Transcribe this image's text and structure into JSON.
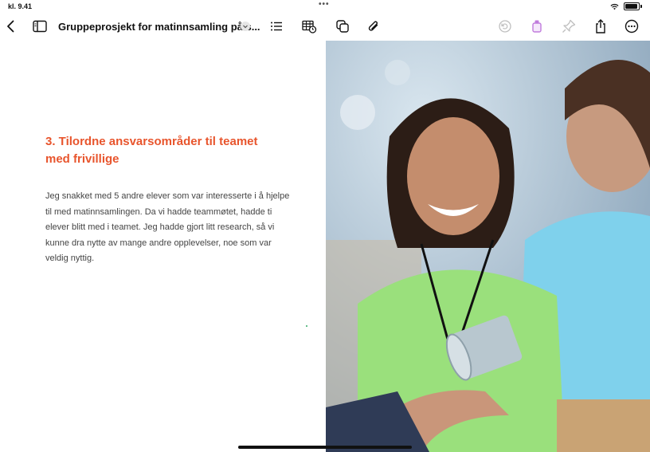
{
  "status_bar": {
    "time": "kl. 9.41",
    "dots": "•••"
  },
  "toolbar": {
    "title": "Gruppeprosjekt for matinnsamling på s..."
  },
  "document": {
    "heading": "3. Tilordne ansvarsområder til teamet med frivillige",
    "body": "Jeg snakket med 5 andre elever som var interesserte i å hjelpe til med matinnsamlingen. Da vi hadde teammøtet, hadde ti elever blitt med i teamet. Jeg hadde gjort litt research, så vi kunne dra nytte av mange andre opplevelser, noe som var veldig nyttig."
  },
  "colors": {
    "heading": "#e8552d",
    "accent_purple": "#c07bdc",
    "disabled_icon": "#bfbfbf"
  },
  "icons": [
    "back-chevron-icon",
    "sidebar-icon",
    "title-chevron-down-icon",
    "list-icon",
    "table-clock-icon",
    "shapes-icon",
    "paperclip-icon",
    "undo-icon",
    "format-brush-icon",
    "pin-icon",
    "share-icon",
    "more-icon",
    "wifi-icon",
    "battery-icon"
  ]
}
